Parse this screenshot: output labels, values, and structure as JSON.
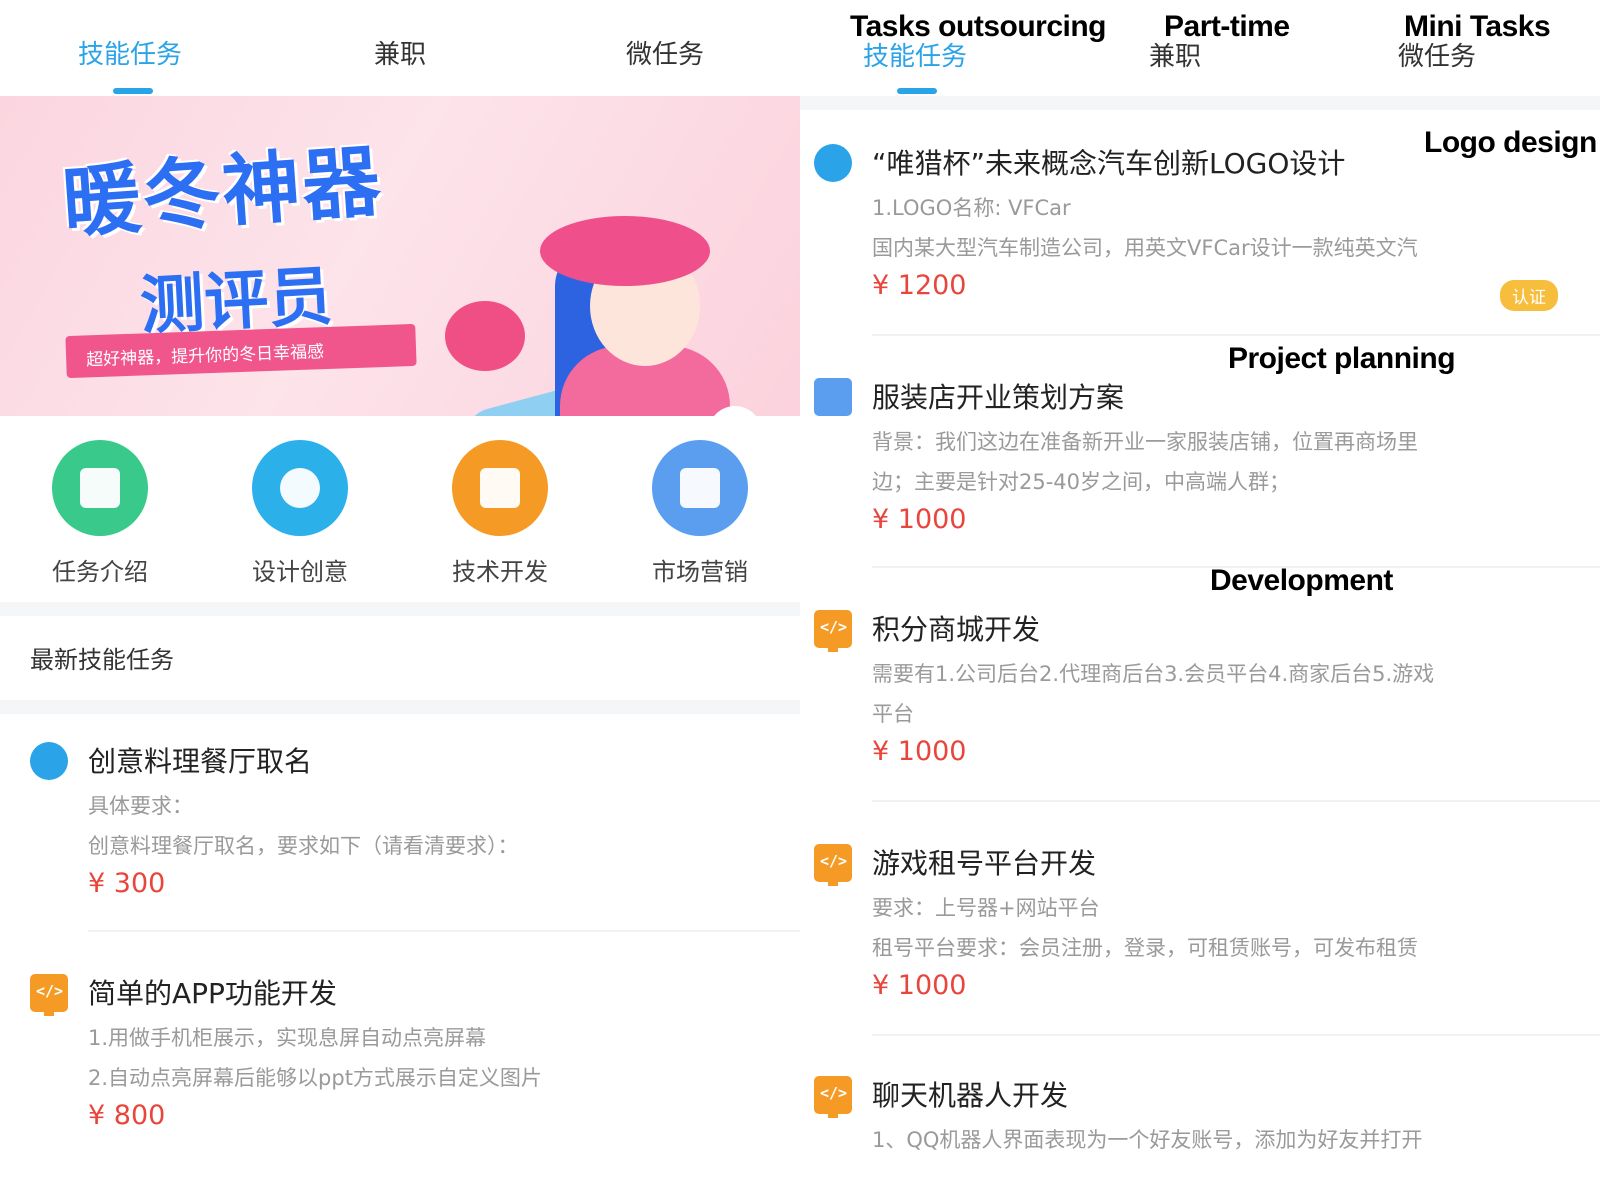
{
  "left": {
    "tabs": [
      {
        "label": "技能任务",
        "active": true
      },
      {
        "label": "兼职",
        "active": false
      },
      {
        "label": "微任务",
        "active": false
      }
    ],
    "banner": {
      "title_line1": "暖冬神器",
      "title_line2": "测评员",
      "ribbon": "超好神器，提升你的冬日幸福感"
    },
    "categories": [
      {
        "label": "任务介绍",
        "icon": "document-icon",
        "color": "#39c98a"
      },
      {
        "label": "设计创意",
        "icon": "palette-icon",
        "color": "#2bb0ea"
      },
      {
        "label": "技术开发",
        "icon": "code-icon",
        "color": "#f59a24"
      },
      {
        "label": "市场营销",
        "icon": "chart-icon",
        "color": "#5b9ef0"
      }
    ],
    "section_title": "最新技能任务",
    "tasks": [
      {
        "title": "创意料理餐厅取名",
        "lines": [
          "具体要求：",
          "创意料理餐厅取名，要求如下（请看清要求）："
        ],
        "price": "¥ 300",
        "icon": "palette-icon"
      },
      {
        "title": "简单的APP功能开发",
        "lines": [
          "1.用做手机柜展示，实现息屏自动点亮屏幕",
          "2.自动点亮屏幕后能够以ppt方式展示自定义图片"
        ],
        "price": "¥ 800",
        "icon": "code-icon"
      }
    ]
  },
  "right": {
    "tabs": [
      {
        "label": "技能任务",
        "active": true
      },
      {
        "label": "兼职",
        "active": false
      },
      {
        "label": "微任务",
        "active": false
      }
    ],
    "tasks": [
      {
        "title": "“唯猎杯”未来概念汽车创新LOGO设计",
        "lines": [
          "1.LOGO名称: VFCar",
          "国内某大型汽车制造公司，用英文VFCar设计一款纯英文汽"
        ],
        "price": "¥ 1200",
        "badge": "认证",
        "icon": "palette-icon"
      },
      {
        "title": "服装店开业策划方案",
        "lines": [
          "背景：我们这边在准备新开业一家服装店铺，位置再商场里",
          "边；主要是针对25-40岁之间，中高端人群；"
        ],
        "price": "¥ 1000",
        "icon": "chart-icon"
      },
      {
        "title": "积分商城开发",
        "lines": [
          "需要有1.公司后台2.代理商后台3.会员平台4.商家后台5.游戏",
          "平台"
        ],
        "price": "¥ 1000",
        "icon": "code-icon"
      },
      {
        "title": "游戏租号平台开发",
        "lines": [
          "要求：上号器+网站平台",
          "租号平台要求：会员注册，登录，可租赁账号，可发布租赁"
        ],
        "price": "¥ 1000",
        "icon": "code-icon"
      },
      {
        "title": "聊天机器人开发",
        "lines": [
          "1、QQ机器人界面表现为一个好友账号，添加为好友并打开"
        ],
        "price": "",
        "icon": "code-icon"
      }
    ]
  },
  "annotations": {
    "tab1": "Tasks outsourcing",
    "tab2": "Part-time",
    "tab3": "Mini Tasks",
    "logo": "Logo design",
    "planning": "Project planning",
    "development": "Development"
  }
}
